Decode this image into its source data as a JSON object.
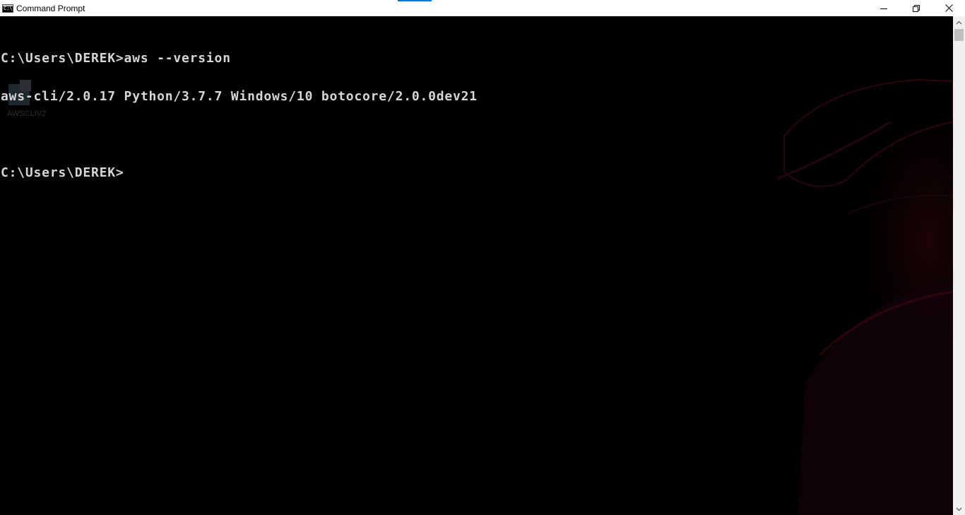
{
  "window": {
    "title": "Command Prompt",
    "app_icon_text": "C:\\",
    "controls": {
      "minimize_icon": "minimize-icon",
      "restore_icon": "restore-icon",
      "close_icon": "close-icon"
    }
  },
  "console": {
    "lines": [
      "C:\\Users\\DEREK>aws --version",
      "aws-cli/2.0.17 Python/3.7.7 Windows/10 botocore/2.0.0dev21",
      "",
      "C:\\Users\\DEREK>"
    ],
    "text_color": "#d6d6d6",
    "background_color": "#000000"
  },
  "desktop_ghost": {
    "icon_label": "AWSCLIV2"
  },
  "colors": {
    "titlebar_bg": "#ffffff",
    "accent": "#0078d7",
    "scrollbar_bg": "#f0f0f0",
    "scrollbar_thumb": "#c1c1c1"
  }
}
